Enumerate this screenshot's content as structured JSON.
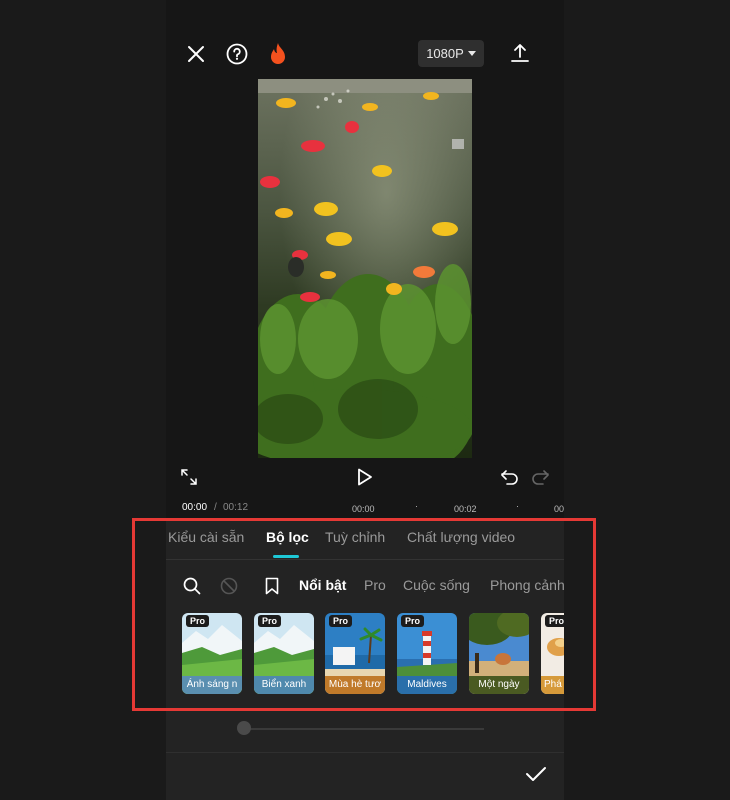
{
  "colors": {
    "accent": "#1ec8d6",
    "highlight": "#e53935",
    "fire": "#f4511e"
  },
  "topbar": {
    "close_icon": "close-icon",
    "help_icon": "help-icon",
    "pro_icon": "flame-icon",
    "resolution": "1080P",
    "export_icon": "upload-icon"
  },
  "playback": {
    "current_time": "00:00",
    "separator": "/",
    "total_time": "00:12",
    "timeline_marks": [
      "00:00",
      "00:02",
      "00"
    ]
  },
  "tabs": [
    {
      "label": "Kiểu cài sẵn"
    },
    {
      "label": "Bộ lọc"
    },
    {
      "label": "Tuỳ chỉnh"
    },
    {
      "label": "Chất lượng video"
    }
  ],
  "categories": [
    {
      "label": "Nổi bật"
    },
    {
      "label": "Pro"
    },
    {
      "label": "Cuộc sống"
    },
    {
      "label": "Phong cảnh"
    }
  ],
  "pro_badge": "Pro",
  "filters": [
    {
      "label": "Ánh sáng n",
      "pro": true
    },
    {
      "label": "Biển xanh",
      "pro": true
    },
    {
      "label": "Mùa hè tươ",
      "pro": true
    },
    {
      "label": "Maldives",
      "pro": true
    },
    {
      "label": "Một ngày",
      "pro": false
    },
    {
      "label": "Phá",
      "pro": true
    }
  ]
}
